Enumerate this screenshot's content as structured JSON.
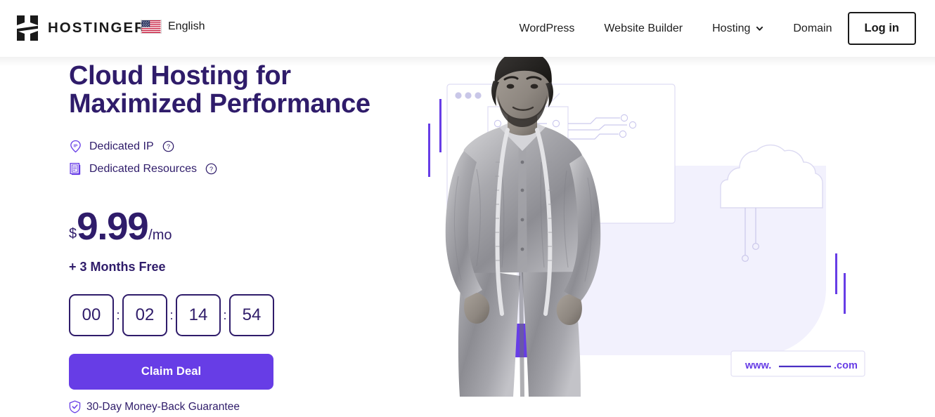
{
  "brand": {
    "name": "HOSTINGER",
    "logo_icon": "hostinger-h-logo"
  },
  "language": {
    "label": "English",
    "flag_icon": "us-flag-icon"
  },
  "nav": {
    "items": [
      {
        "label": "WordPress",
        "has_chevron": false
      },
      {
        "label": "Website Builder",
        "has_chevron": false
      },
      {
        "label": "Hosting",
        "has_chevron": true
      },
      {
        "label": "Domain",
        "has_chevron": false
      }
    ],
    "login_label": "Log in"
  },
  "hero": {
    "headline": "Cloud Hosting for\nMaximized Performance",
    "features": [
      {
        "label": "Dedicated IP",
        "icon": "ip-pin-icon",
        "help_icon": "question-mark-icon"
      },
      {
        "label": "Dedicated Resources",
        "icon": "resources-document-icon",
        "help_icon": "question-mark-icon"
      }
    ],
    "price": {
      "currency": "$",
      "amount": "9.99",
      "period": "/mo"
    },
    "bonus": "+ 3 Months Free",
    "timer": {
      "days": "00",
      "hours": "02",
      "minutes": "14",
      "seconds": "54",
      "separator": ":"
    },
    "cta_label": "Claim Deal",
    "guarantee": {
      "label": "30-Day Money-Back Guarantee",
      "icon": "shield-check-icon"
    }
  },
  "art": {
    "url_bar": {
      "prefix": "www.",
      "suffix": ".com"
    },
    "colors": {
      "accent_purple": "#673de6",
      "deep_purple": "#2f1c6a",
      "panel_lavender": "#f2f1fd",
      "line_lavender": "#d8d6f2"
    }
  }
}
